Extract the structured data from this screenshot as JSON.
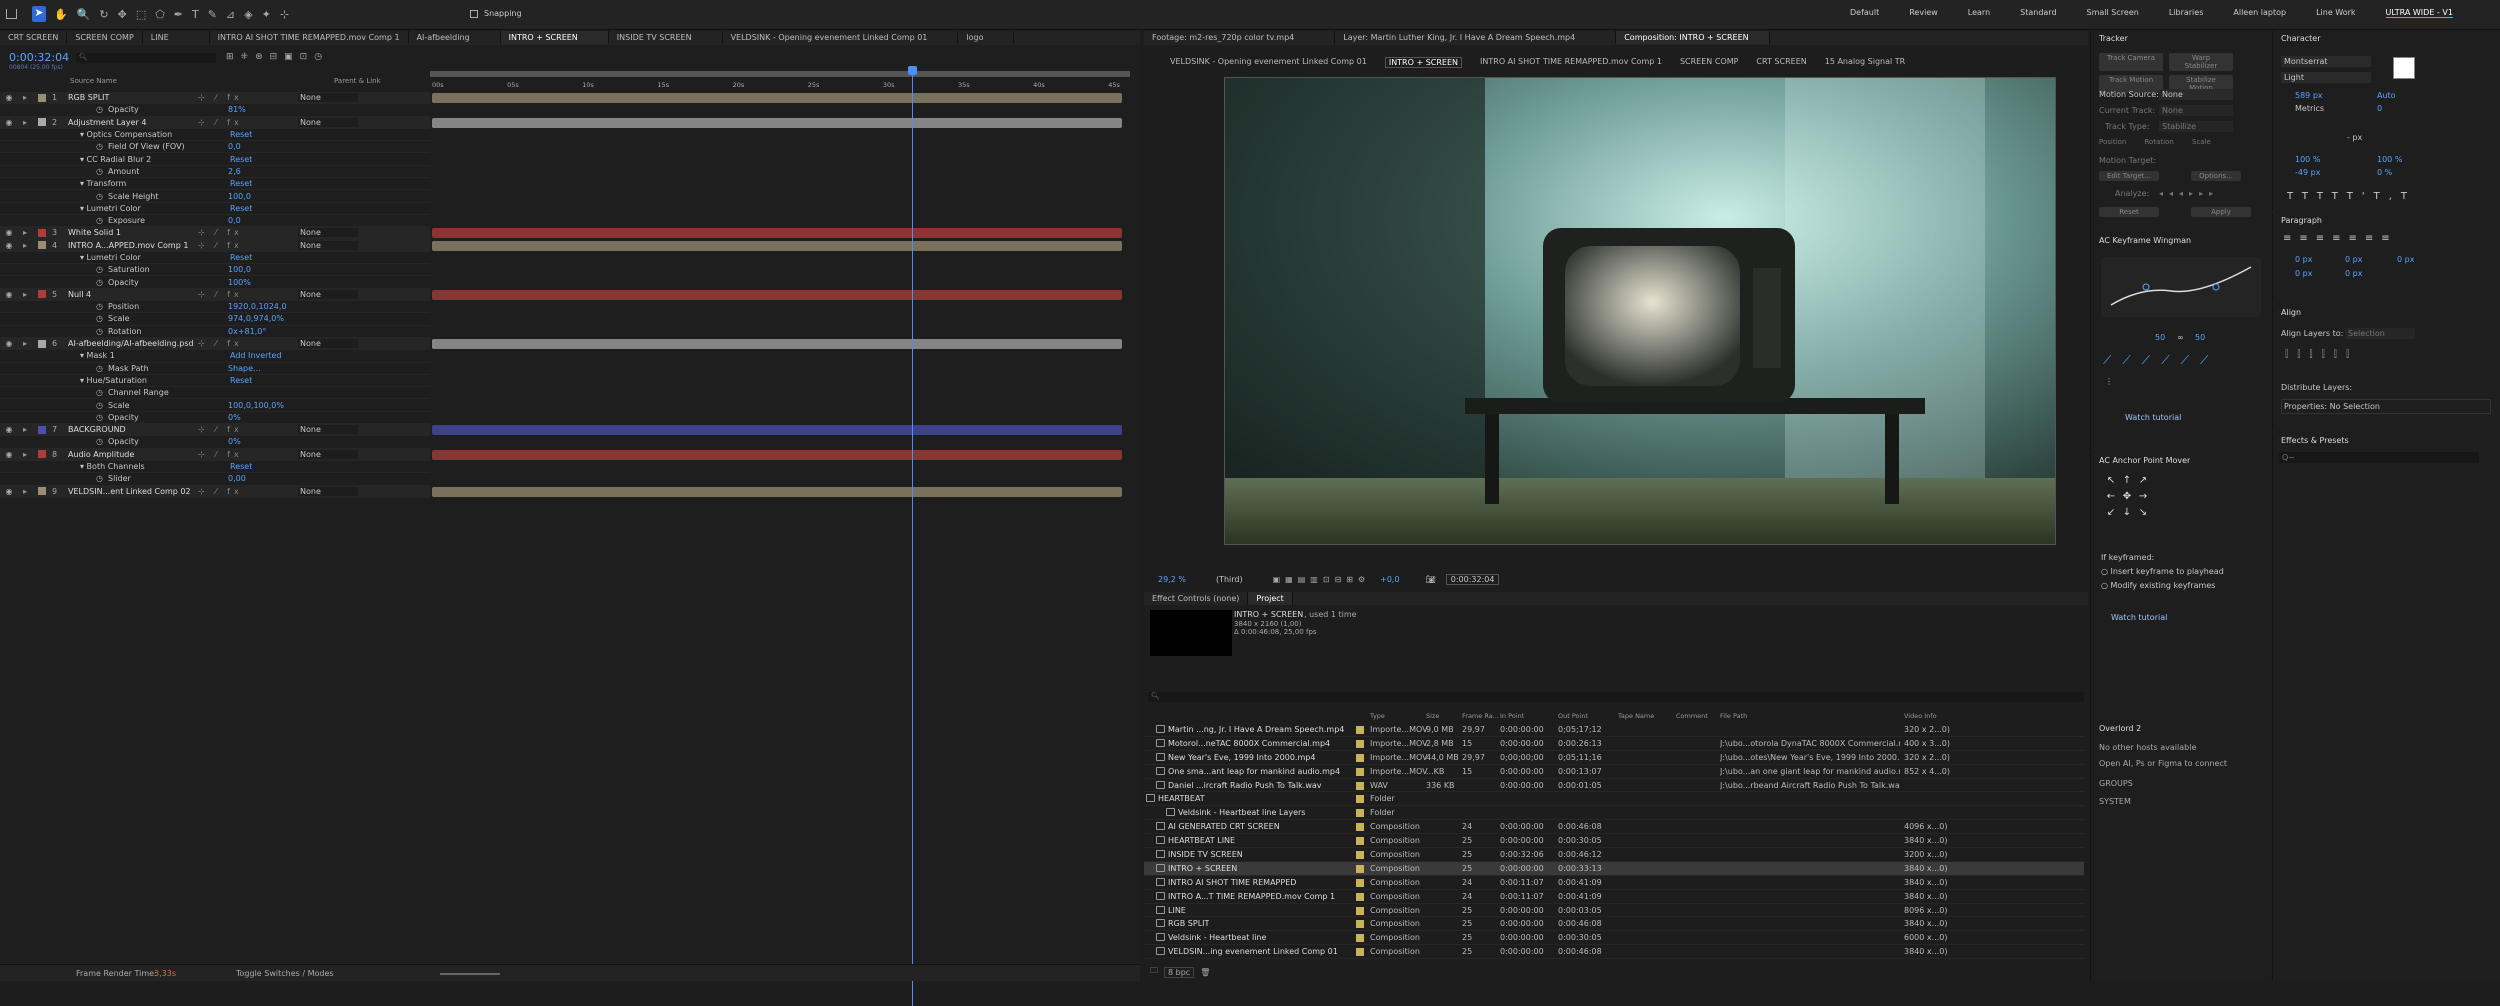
{
  "toolbar": {
    "snapping": "Snapping",
    "workspaces": [
      "Default",
      "Review",
      "Learn",
      "Standard",
      "Small Screen",
      "Libraries",
      "Alleen laptop",
      "Line Work",
      "ULTRA WIDE - V1"
    ]
  },
  "timeline": {
    "tabs": [
      "CRT SCREEN",
      "SCREEN COMP",
      "LINE",
      "INTRO AI SHOT TIME REMAPPED.mov Comp 1",
      "AI-afbeelding",
      "INTRO + SCREEN",
      "INSIDE TV SCREEN",
      "VELDSINK - Opening evenement Linked Comp 01",
      "logo"
    ],
    "timecode": "0:00:32:04",
    "timecode_sub": "00804 (25.00 fps)",
    "columns": {
      "source_name": "Source Name",
      "parent": "Parent & Link"
    },
    "ruler": [
      "00s",
      "05s",
      "10s",
      "15s",
      "20s",
      "25s",
      "30s",
      "35s",
      "40s",
      "45s"
    ],
    "layers": [
      {
        "num": "1",
        "name": "RGB SPLIT",
        "parent": "None",
        "color": "#9a8e73"
      },
      {
        "prop": "Opacity",
        "val": "81%"
      },
      {
        "num": "2",
        "name": "Adjustment Layer 4",
        "parent": "None",
        "color": "#a8a8a8"
      },
      {
        "group": "Optics Compensation",
        "reset": "Reset"
      },
      {
        "prop": "Field Of View (FOV)",
        "val": "0,0"
      },
      {
        "group": "CC Radial Blur 2",
        "reset": "Reset"
      },
      {
        "prop": "Amount",
        "val": "2,6"
      },
      {
        "group": "Transform",
        "reset": "Reset"
      },
      {
        "prop": "Scale Height",
        "val": "100,0"
      },
      {
        "group": "Lumetri Color",
        "reset": "Reset"
      },
      {
        "prop": "Exposure",
        "val": "0,0"
      },
      {
        "num": "3",
        "name": "White Solid 1",
        "parent": "None",
        "color": "#b03c3c"
      },
      {
        "num": "4",
        "name": "INTRO A...APPED.mov Comp 1",
        "parent": "None",
        "color": "#9a8e73"
      },
      {
        "group": "Lumetri Color",
        "reset": "Reset"
      },
      {
        "prop": "Saturation",
        "val": "100,0"
      },
      {
        "prop": "Opacity",
        "val": "100%"
      },
      {
        "num": "5",
        "name": "Null 4",
        "parent": "None",
        "color": "#b03c3c"
      },
      {
        "prop": "Position",
        "val": "1920,0,1024,0"
      },
      {
        "prop": "Scale",
        "val": "974,0,974,0%"
      },
      {
        "prop": "Rotation",
        "val": "0x+81,0°"
      },
      {
        "num": "6",
        "name": "AI-afbeelding/AI-afbeelding.psd",
        "parent": "None",
        "color": "#a8a8a8"
      },
      {
        "group": "Mask 1",
        "mode": "Add",
        "inverted": "Inverted"
      },
      {
        "prop": "Mask Path",
        "val": "Shape..."
      },
      {
        "group": "Hue/Saturation",
        "reset": "Reset"
      },
      {
        "prop": "Channel Range",
        "val": ""
      },
      {
        "prop": "Scale",
        "val": "100,0,100,0%"
      },
      {
        "prop": "Opacity",
        "val": "0%"
      },
      {
        "num": "7",
        "name": "BACKGROUND",
        "parent": "None",
        "color": "#4a4fb0"
      },
      {
        "prop": "Opacity",
        "val": "0%"
      },
      {
        "num": "8",
        "name": "Audio Amplitude",
        "parent": "None",
        "color": "#b03c3c"
      },
      {
        "group": "Both Channels",
        "reset": "Reset"
      },
      {
        "prop": "Slider",
        "val": "0,00"
      },
      {
        "num": "9",
        "name": "VELDSIN...ent Linked Comp 02",
        "parent": "None",
        "color": "#9a8e73"
      }
    ],
    "footer": {
      "render_label": "Frame Render Time:",
      "render_val": "3,33s",
      "toggle": "Toggle Switches / Modes"
    }
  },
  "viewer": {
    "tabs": [
      "Footage: m2-res_720p color tv.mp4",
      "Layer: Martin Luther King, Jr. I Have A Dream Speech.mp4",
      "Composition: INTRO + SCREEN"
    ],
    "breadcrumbs": [
      "VELDSINK - Opening evenement Linked Comp 01",
      "INTRO + SCREEN",
      "INTRO AI SHOT TIME REMAPPED.mov Comp 1",
      "SCREEN COMP",
      "CRT SCREEN",
      "15 Analog Signal TR"
    ],
    "zoom": "29,2 %",
    "resolution": "(Third)",
    "exposure": "+0,0",
    "timecode": "0:00:32:04"
  },
  "project": {
    "tabs": [
      "Effect Controls (none)",
      "Project"
    ],
    "selected_name": "INTRO + SCREEN",
    "used": ", used 1 time",
    "info": [
      "3840 x 2160 (1,00)",
      "Δ 0:00:46:08, 25,00 fps"
    ],
    "columns": [
      "Type",
      "Size",
      "Frame Ra...",
      "In Point",
      "Out Point",
      "Tape Name",
      "Comment",
      "File Path",
      "Video Info"
    ],
    "rows": [
      {
        "name": "Martin ...ng, Jr. I Have A Dream Speech.mp4",
        "type": "Importe...MOV",
        "size": "9,0 MB",
        "fr": "29,97",
        "in": "0:00:00:00",
        "out": "0;05;17;12",
        "path": "",
        "vinfo": "320 x 2...0)",
        "color": "#c9b35a"
      },
      {
        "name": "Motorol...neTAC 8000X Commercial.mp4",
        "type": "Importe...MOV",
        "size": "2,8 MB",
        "fr": "15",
        "in": "0:00:00:00",
        "out": "0:00:26:13",
        "path": "J:\\ubo...otorola DynaTAC 8000X Commercial.mp4",
        "vinfo": "400 x 3...0)",
        "color": "#c9b35a"
      },
      {
        "name": "New Year's Eve, 1999 Into 2000.mp4",
        "type": "Importe...MOV",
        "size": "44,0 MB",
        "fr": "29,97",
        "in": "0;00;00;00",
        "out": "0;05;11;16",
        "path": "J:\\ubo...otes\\New Year's Eve, 1999 Into 2000.mp4",
        "vinfo": "320 x 2...0)",
        "color": "#c9b35a"
      },
      {
        "name": "One sma...ant leap for mankind audio.mp4",
        "type": "Importe...MOV",
        "size": "...KB",
        "fr": "15",
        "in": "0:00:00:00",
        "out": "0:00:13:07",
        "path": "J:\\ubo...an one giant leap for mankind audio.mp4",
        "vinfo": "852 x 4...0)",
        "color": "#c9b35a"
      },
      {
        "name": "Daniel ...ircraft Radio Push To Talk.wav",
        "type": "WAV",
        "size": "336 KB",
        "fr": "",
        "in": "0:00:00:00",
        "out": "0:00:01:05",
        "path": "J:\\ubo...rbeand Aircraft Radio Push To Talk.wav",
        "vinfo": "",
        "color": "#c9b35a"
      },
      {
        "name": "HEARTBEAT",
        "type": "Folder",
        "size": "",
        "fr": "",
        "in": "",
        "out": "",
        "path": "",
        "vinfo": "",
        "color": "#c9b35a",
        "folder": true
      },
      {
        "name": "Veldsink - Heartbeat line Layers",
        "type": "Folder",
        "size": "",
        "fr": "",
        "in": "",
        "out": "",
        "path": "",
        "vinfo": "",
        "color": "#c9b35a",
        "folder": true,
        "indent": true
      },
      {
        "name": "AI GENERATED CRT SCREEN",
        "type": "Composition",
        "size": "",
        "fr": "24",
        "in": "0:00:00:00",
        "out": "0:00:46:08",
        "path": "",
        "vinfo": "4096 x...0)",
        "color": "#c9b35a"
      },
      {
        "name": "HEARTBEAT LINE",
        "type": "Composition",
        "size": "",
        "fr": "25",
        "in": "0:00:00:00",
        "out": "0:00:30:05",
        "path": "",
        "vinfo": "3840 x...0)",
        "color": "#c9b35a"
      },
      {
        "name": "INSIDE TV SCREEN",
        "type": "Composition",
        "size": "",
        "fr": "25",
        "in": "0:00:32:06",
        "out": "0:00:46:12",
        "path": "",
        "vinfo": "3200 x...0)",
        "color": "#c9b35a"
      },
      {
        "name": "INTRO + SCREEN",
        "type": "Composition",
        "size": "",
        "fr": "25",
        "in": "0:00:00:00",
        "out": "0:00:33:13",
        "path": "",
        "vinfo": "3840 x...0)",
        "color": "#c9b35a",
        "selected": true
      },
      {
        "name": "INTRO AI SHOT TIME REMAPPED",
        "type": "Composition",
        "size": "",
        "fr": "24",
        "in": "0:00:11:07",
        "out": "0:00:41:09",
        "path": "",
        "vinfo": "3840 x...0)",
        "color": "#c9b35a"
      },
      {
        "name": "INTRO A...T TIME REMAPPED.mov Comp 1",
        "type": "Composition",
        "size": "",
        "fr": "24",
        "in": "0:00:11:07",
        "out": "0:00:41:09",
        "path": "",
        "vinfo": "3840 x...0)",
        "color": "#c9b35a"
      },
      {
        "name": "LINE",
        "type": "Composition",
        "size": "",
        "fr": "25",
        "in": "0:00:00:00",
        "out": "0:00:03:05",
        "path": "",
        "vinfo": "8096 x...0)",
        "color": "#c9b35a"
      },
      {
        "name": "RGB SPLIT",
        "type": "Composition",
        "size": "",
        "fr": "25",
        "in": "0:00:00:00",
        "out": "0:00:46:08",
        "path": "",
        "vinfo": "3840 x...0)",
        "color": "#c9b35a"
      },
      {
        "name": "Veldsink - Heartbeat line",
        "type": "Composition",
        "size": "",
        "fr": "25",
        "in": "0:00:00:00",
        "out": "0:00:30:05",
        "path": "",
        "vinfo": "6000 x...0)",
        "color": "#c9b35a"
      },
      {
        "name": "VELDSIN...ing evenement Linked Comp 01",
        "type": "Composition",
        "size": "",
        "fr": "25",
        "in": "0:00:00:00",
        "out": "0:00:46:08",
        "path": "",
        "vinfo": "3840 x...0)",
        "color": "#c9b35a"
      }
    ],
    "bpc": "8 bpc"
  },
  "tracker": {
    "title": "Tracker",
    "buttons": [
      "Track Camera",
      "Warp Stabilizer",
      "Track Motion",
      "Stabilize Motion"
    ],
    "motion_source_label": "Motion Source:",
    "motion_source": "None",
    "current_track_label": "Current Track:",
    "current_track": "None",
    "track_type_label": "Track Type:",
    "track_type": "Stabilize",
    "checks": [
      "Position",
      "Rotation",
      "Scale"
    ],
    "motion_target": "Motion Target:",
    "edit_target": "Edit Target...",
    "options": "Options...",
    "analyze": "Analyze:",
    "reset": "Reset",
    "apply": "Apply"
  },
  "keyframe_wingman": {
    "title": "AC Keyframe Wingman",
    "val1": "50",
    "val2": "50",
    "tutorial": "Watch tutorial"
  },
  "anchor_mover": {
    "title": "AC Anchor Point Mover",
    "if_keyframed": "If keyframed:",
    "opt1": "Insert keyframe to playhead",
    "opt2": "Modify existing keyframes",
    "tutorial": "Watch tutorial"
  },
  "overlord": {
    "title": "Overlord 2",
    "no_hosts": "No other hosts available",
    "open": "Open AI, Ps or Figma to connect",
    "groups": "GROUPS",
    "system": "SYSTEM"
  },
  "character": {
    "title": "Character",
    "font": "Montserrat",
    "style": "Light",
    "size": "589 px",
    "leading": "Auto",
    "metrics": "Metrics",
    "tracking": "0",
    "unit": "- px",
    "vscale": "100 %",
    "hscale": "100 %",
    "baseline": "-49 px",
    "tsume": "0 %"
  },
  "paragraph": {
    "title": "Paragraph",
    "vals": [
      "0 px",
      "0 px",
      "0 px",
      "0 px",
      "0 px"
    ]
  },
  "align": {
    "title": "Align",
    "align_to_label": "Align Layers to:",
    "align_to": "Selection",
    "distribute": "Distribute Layers:",
    "properties": "Properties: No Selection"
  },
  "effects": {
    "title": "Effects & Presets",
    "search_placeholder": "Q~"
  }
}
